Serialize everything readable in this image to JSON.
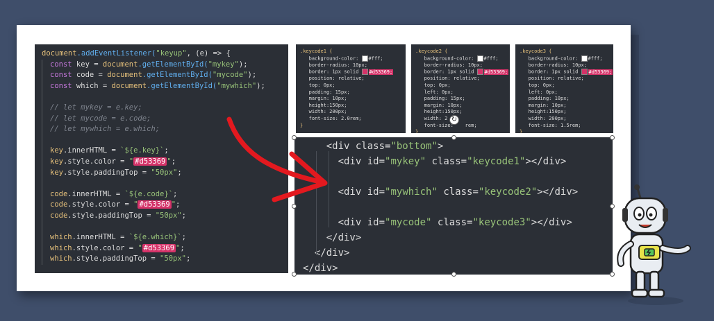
{
  "js_code": {
    "line1": {
      "obj": "document",
      "fn": ".addEventListener(",
      "str": "\"keyup\"",
      "rest": ", (e) => {"
    },
    "line2": {
      "kw": "const",
      "name": " key = ",
      "obj": "document",
      "fn": ".getElementById(",
      "str": "\"mykey\"",
      "end": ");"
    },
    "line3": {
      "kw": "const",
      "name": " code = ",
      "obj": "document",
      "fn": ".getElementById(",
      "str": "\"mycode\"",
      "end": ");"
    },
    "line4": {
      "kw": "const",
      "name": " which = ",
      "obj": "document",
      "fn": ".getElementById(",
      "str": "\"mywhich\"",
      "end": ");"
    },
    "comment1": "// let mykey = e.key;",
    "comment2": "// let mycode = e.code;",
    "comment3": "// let mywhich = e.which;",
    "key_inner": {
      "a": "key",
      "b": ".innerHTML = ",
      "c": "`${e.key}`",
      "d": ";"
    },
    "key_color": {
      "a": "key",
      "b": ".style.color = ",
      "q1": "\"",
      "hl": "#d53369",
      "q2": "\"",
      "d": ";"
    },
    "key_pad": {
      "a": "key",
      "b": ".style.paddingTop = ",
      "c": "\"50px\"",
      "d": ";"
    },
    "code_inner": {
      "a": "code",
      "b": ".innerHTML = ",
      "c": "`${e.code}`",
      "d": ";"
    },
    "code_color": {
      "a": "code",
      "b": ".style.color = ",
      "q1": "\"",
      "hl": "#d53369",
      "q2": "\"",
      "d": ";"
    },
    "code_pad": {
      "a": "code",
      "b": ".style.paddingTop = ",
      "c": "\"50px\"",
      "d": ";"
    },
    "which_inner": {
      "a": "which",
      "b": ".innerHTML = ",
      "c": "`${e.which}`",
      "d": ";"
    },
    "which_color": {
      "a": "which",
      "b": ".style.color = ",
      "q1": "\"",
      "hl": "#d53369",
      "q2": "\"",
      "d": ";"
    },
    "which_pad": {
      "a": "which",
      "b": ".style.paddingTop = ",
      "c": "\"50px\"",
      "d": ";"
    }
  },
  "css1": {
    "selector": ".keycode1 {",
    "bg": "background-color: ",
    "bg_val": "#fff;",
    "radius": "border-radius: 10px;",
    "border": "border: 1px solid ",
    "border_val": "#d53369;",
    "position": "position: relative;",
    "top": "top: 0px;",
    "padding": "padding: 15px;",
    "margin": "margin: 10px;",
    "height": "height:150px;",
    "width": "width: 200px;",
    "font": "font-size: 2.0rem;",
    "close": "}"
  },
  "css2": {
    "selector": ".keycode2 {",
    "bg": "background-color: ",
    "bg_val": "#fff;",
    "radius": "border-radius: 10px;",
    "border": "border: 1px solid ",
    "border_val": "#d53369;",
    "position": "position: relative;",
    "top": "top: 0px;",
    "left": "left: 0px;",
    "padding": "padding: 15px;",
    "margin": "margin: 10px;",
    "height": "height:150px;",
    "width": "width: 2",
    "font": "font-size:",
    "font_tail": "rem;",
    "close": "}"
  },
  "css3": {
    "selector": ".keycode3 {",
    "bg": "background-color: ",
    "bg_val": "#fff;",
    "radius": "border-radius: 10px;",
    "border": "border: 1px solid ",
    "border_val": "#d53369;",
    "position": "position: relative;",
    "top": "top: 0px;",
    "left": "left: 0px;",
    "padding": "padding: 10px;",
    "margin": "margin: 10px;",
    "height": "height:150px;",
    "width": "width: 200px;",
    "font": "font-size: 1.5rem;",
    "close": "}"
  },
  "html_code": {
    "l1": {
      "open": "<div ",
      "attr": "class=",
      "val": "\"bottom\"",
      "close": ">"
    },
    "l2": {
      "open": "<div ",
      "attr1": "id=",
      "val1": "\"mykey\"",
      "attr2": " class=",
      "val2": "\"keycode1\"",
      "close": "></div>"
    },
    "l3": {
      "open": "<div ",
      "attr1": "id=",
      "val1": "\"mywhich\"",
      "attr2": " class=",
      "val2": "\"keycode2\"",
      "close": "></div>"
    },
    "l4": {
      "open": "<div ",
      "attr1": "id=",
      "val1": "\"mycode\"",
      "attr2": " class=",
      "val2": "\"keycode3\"",
      "close": "></div>"
    },
    "l5": "</div>",
    "l6": "</div>",
    "l7": "</div>"
  },
  "colors": {
    "background": "#3f4e6a",
    "highlight": "#d53369",
    "arrow": "#e3191f",
    "panel": "#2b2f36"
  },
  "icons": {
    "rotate": "rotate-handle-icon",
    "mascot": "robot-mascot-icon",
    "arrow": "curved-arrow-icon"
  }
}
